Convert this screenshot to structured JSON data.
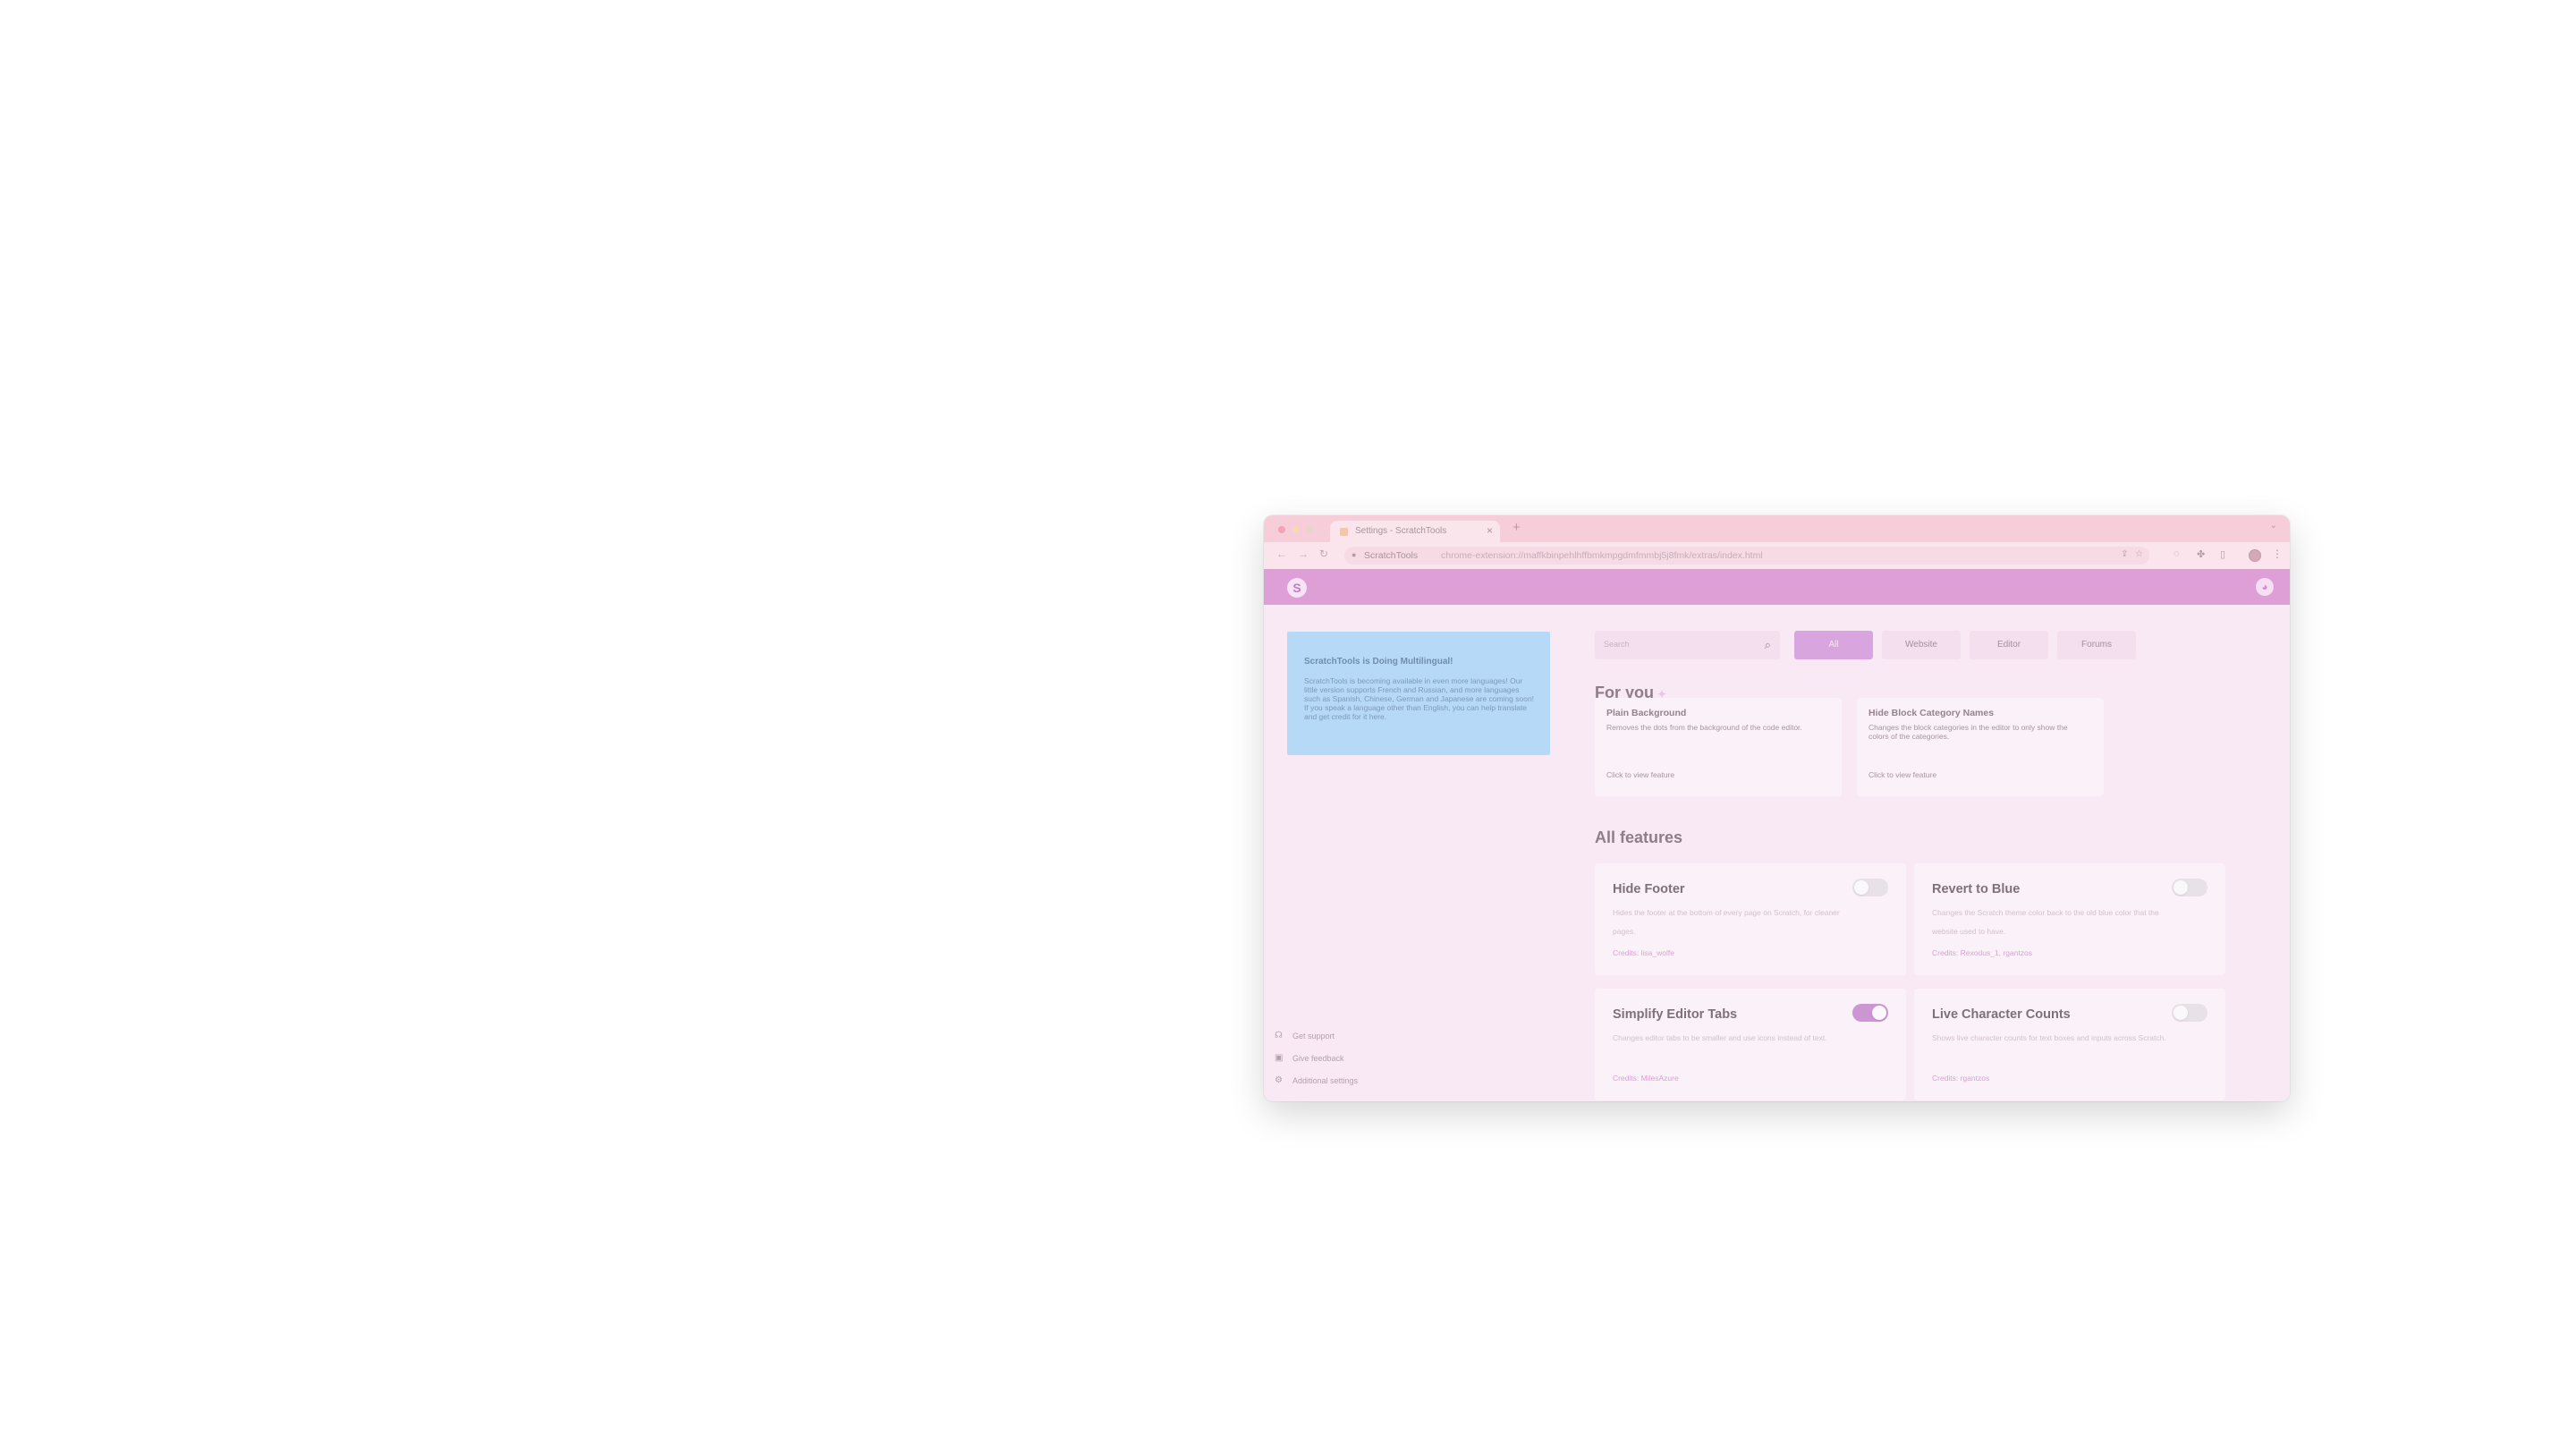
{
  "browser": {
    "tab_title": "Settings - ScratchTools",
    "tab_close": "×",
    "new_tab": "+",
    "url_host": "ScratchTools",
    "url_path": "chrome-extension://maffkbinpehlhffbmkmpgdmfmmbj5j8fmk/extras/index.html"
  },
  "app": {
    "logo_glyph": "S"
  },
  "promo": {
    "title": "ScratchTools is Doing Multilingual!",
    "body": "ScratchTools is becoming available in even more languages! Our little version supports French and Russian, and more languages such as Spanish, Chinese, German and Japanese are coming soon! If you speak a language other than English, you can help translate and get credit for it here."
  },
  "sidebar": {
    "links": [
      {
        "label": "Get support",
        "icon": "support-icon"
      },
      {
        "label": "Give feedback",
        "icon": "feedback-icon"
      },
      {
        "label": "Additional settings",
        "icon": "settings-icon"
      }
    ]
  },
  "search": {
    "placeholder": "Search"
  },
  "filters": [
    {
      "label": "All",
      "active": true
    },
    {
      "label": "Website",
      "active": false
    },
    {
      "label": "Editor",
      "active": false
    },
    {
      "label": "Forums",
      "active": false
    }
  ],
  "for_you": {
    "heading": "For you",
    "cards": [
      {
        "title": "Plain Background",
        "description": "Removes the dots from the background of the code editor.",
        "link": "Click to view feature"
      },
      {
        "title": "Hide Block Category Names",
        "description": "Changes the block categories in the editor to only show the colors of the categories.",
        "link": "Click to view feature"
      }
    ]
  },
  "all_features": {
    "heading": "All features",
    "cards": [
      {
        "title": "Hide Footer",
        "description": "Hides the footer at the bottom of every page on Scratch, for cleaner pages.",
        "credits": "Credits: lisa_wolfe",
        "enabled": false
      },
      {
        "title": "Revert to Blue",
        "description": "Changes the Scratch theme color back to the old blue color that the website used to have.",
        "credits": "Credits: Rexodus_1, rgantzos",
        "enabled": false
      },
      {
        "title": "Simplify Editor Tabs",
        "description": "Changes editor tabs to be smaller and use icons instead of text.",
        "credits": "Credits: MilesAzure",
        "enabled": true
      },
      {
        "title": "Live Character Counts",
        "description": "Shows live character counts for text boxes and inputs across Scratch.",
        "credits": "Credits: rgantzos",
        "enabled": false
      }
    ]
  }
}
